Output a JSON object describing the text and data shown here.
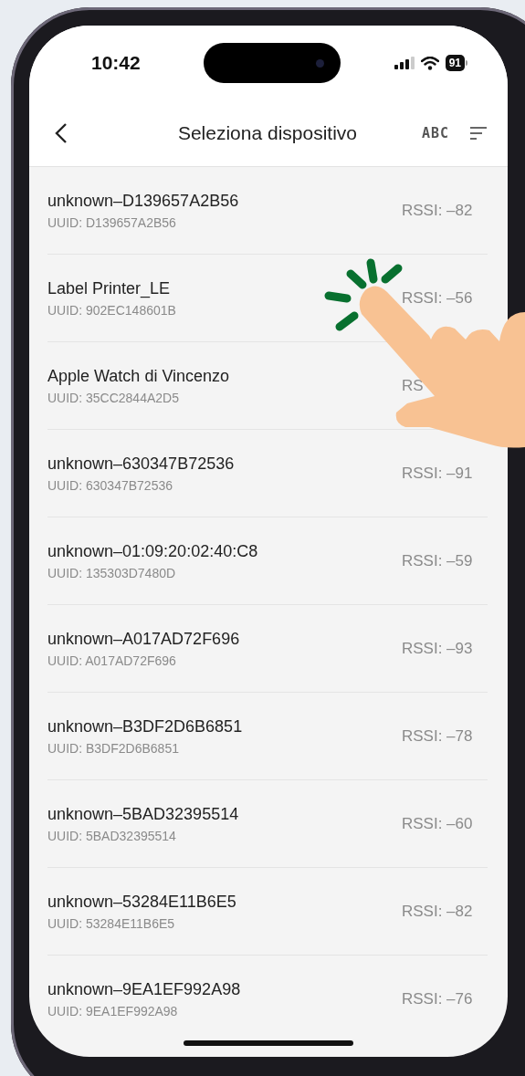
{
  "status_bar": {
    "time": "10:42",
    "battery": "91"
  },
  "nav": {
    "title": "Seleziona dispositivo",
    "sort_label": "ABC"
  },
  "devices": [
    {
      "name": "unknown–D139657A2B56",
      "uuid": "UUID: D139657A2B56",
      "rssi": "RSSI: –82"
    },
    {
      "name": "Label Printer_LE",
      "uuid": "UUID: 902EC148601B",
      "rssi": "RSSI: –56"
    },
    {
      "name": "Apple Watch di Vincenzo",
      "uuid": "UUID: 35CC2844A2D5",
      "rssi": "RS"
    },
    {
      "name": "unknown–630347B72536",
      "uuid": "UUID: 630347B72536",
      "rssi": "RSSI: –91"
    },
    {
      "name": "unknown–01:09:20:02:40:C8",
      "uuid": "UUID: 135303D7480D",
      "rssi": "RSSI: –59"
    },
    {
      "name": "unknown–A017AD72F696",
      "uuid": "UUID: A017AD72F696",
      "rssi": "RSSI: –93"
    },
    {
      "name": "unknown–B3DF2D6B6851",
      "uuid": "UUID: B3DF2D6B6851",
      "rssi": "RSSI: –78"
    },
    {
      "name": "unknown–5BAD32395514",
      "uuid": "UUID: 5BAD32395514",
      "rssi": "RSSI: –60"
    },
    {
      "name": "unknown–53284E11B6E5",
      "uuid": "UUID: 53284E11B6E5",
      "rssi": "RSSI: –82"
    },
    {
      "name": "unknown–9EA1EF992A98",
      "uuid": "UUID: 9EA1EF992A98",
      "rssi": "RSSI: –76"
    }
  ]
}
